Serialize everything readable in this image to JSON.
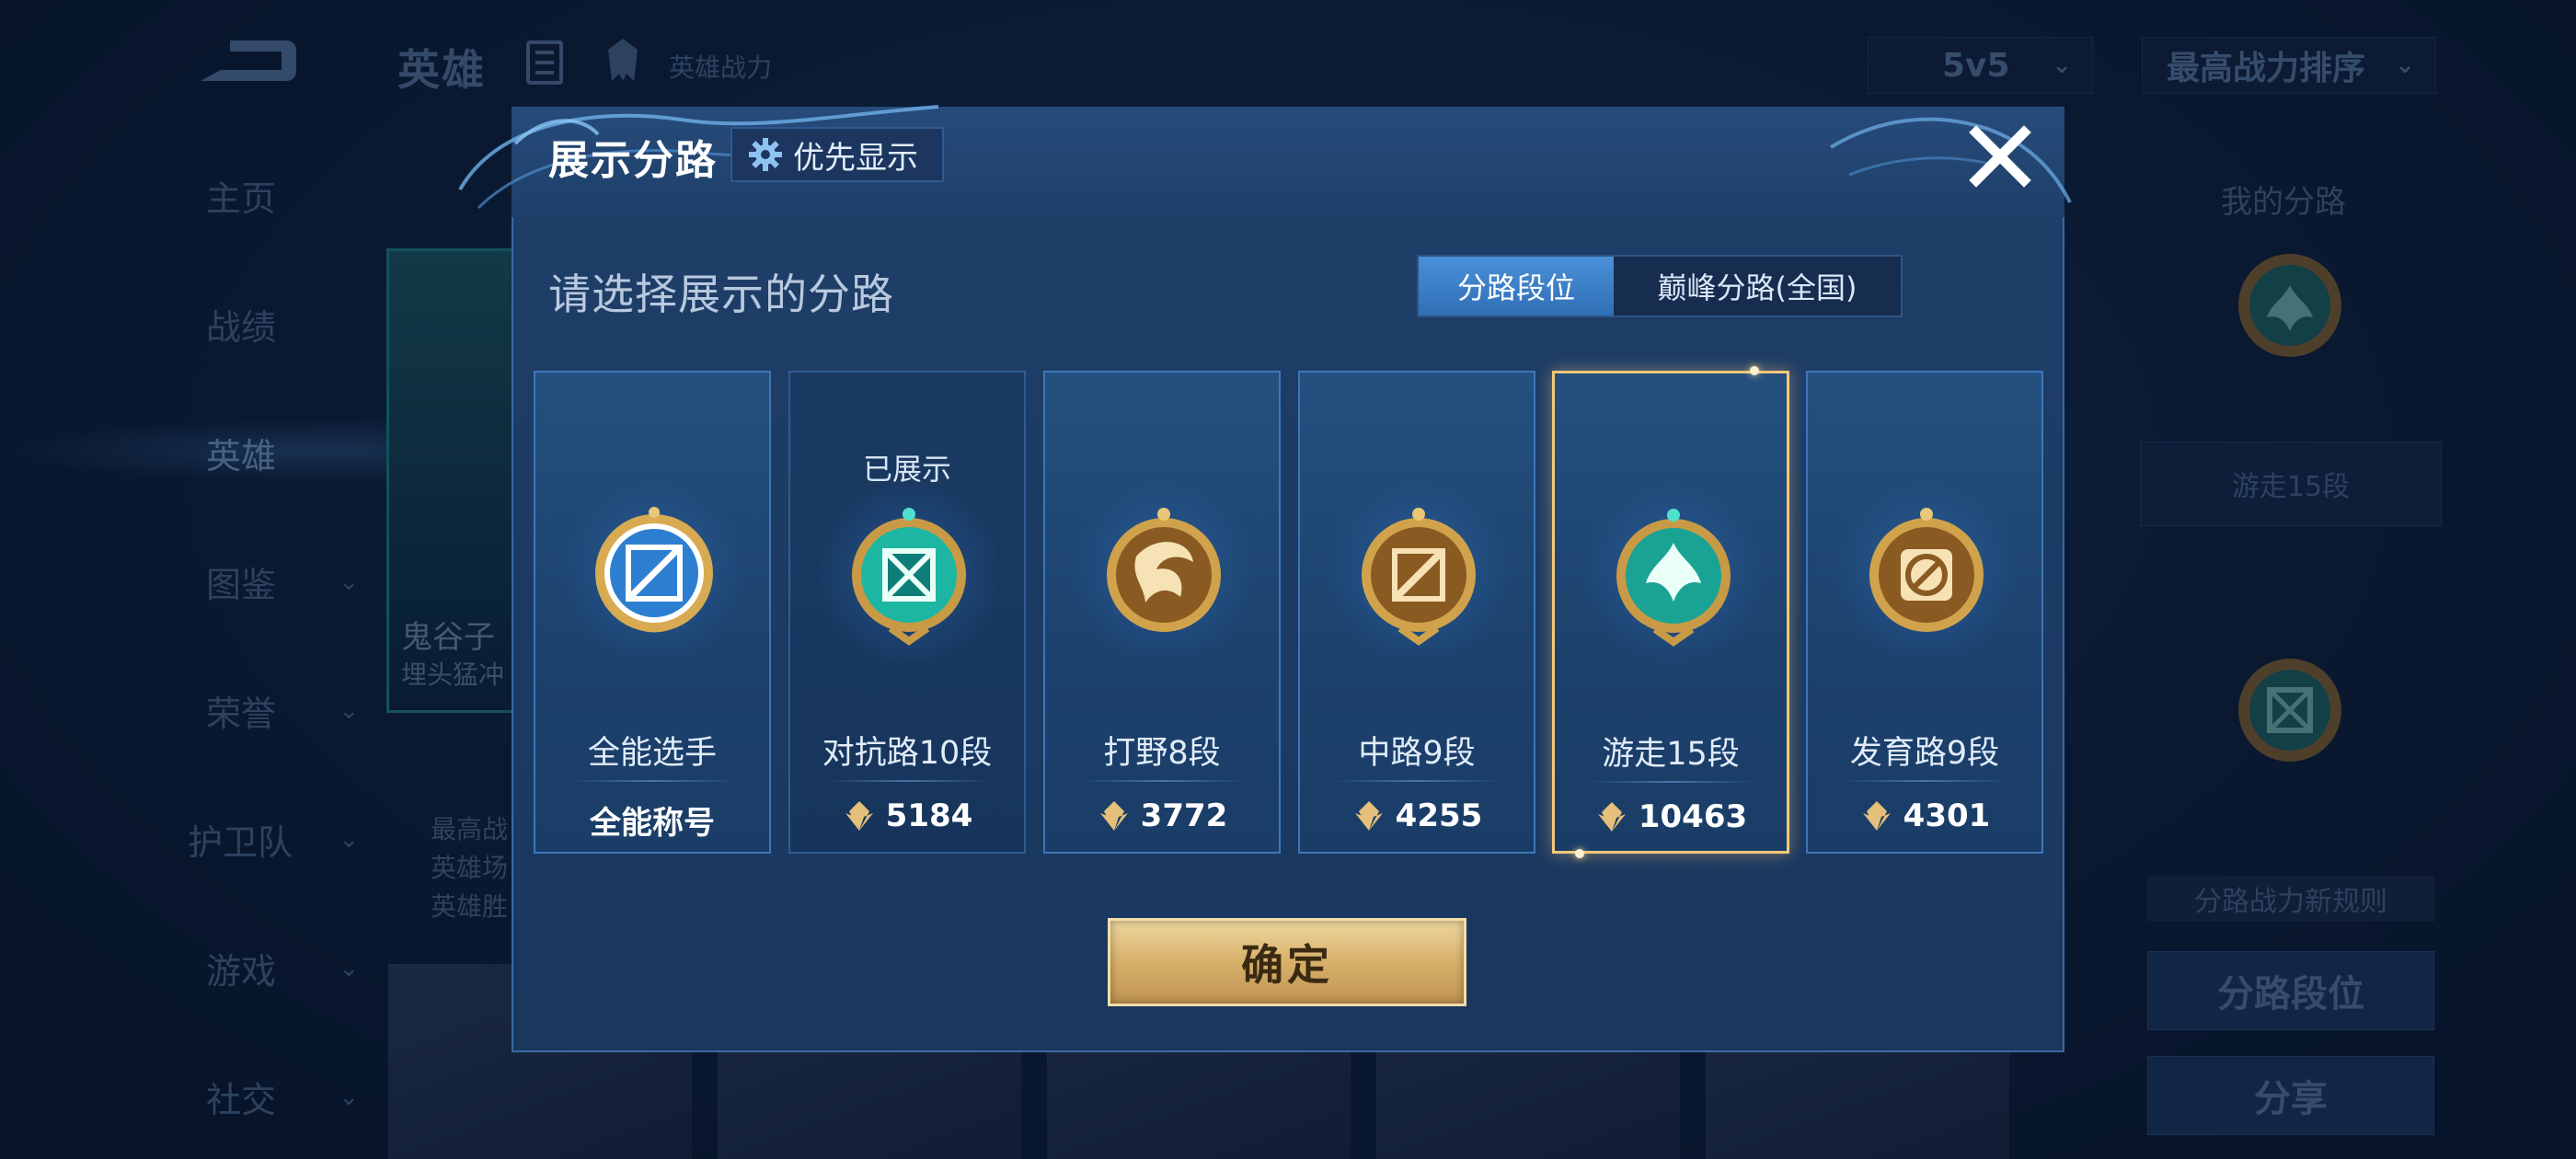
{
  "background": {
    "title": "英雄",
    "power_label": "英雄战力",
    "mode_dropdown": "5v5",
    "sort_dropdown": "最高战力排序",
    "sidebar": [
      {
        "label": "主页",
        "has_chevron": false
      },
      {
        "label": "战绩",
        "has_chevron": false
      },
      {
        "label": "英雄",
        "has_chevron": false,
        "active": true
      },
      {
        "label": "图鉴",
        "has_chevron": true
      },
      {
        "label": "荣誉",
        "has_chevron": true
      },
      {
        "label": "护卫队",
        "has_chevron": true
      },
      {
        "label": "游戏",
        "has_chevron": true
      },
      {
        "label": "社交",
        "has_chevron": true
      }
    ],
    "hero_name": "鬼谷子",
    "hero_subtitle": "埋头猛冲",
    "hero_info": [
      "最高战",
      "英雄场",
      "英雄胜"
    ],
    "right_panel": {
      "title": "我的分路",
      "current_lane": "游走15段",
      "rule_link": "分路战力新规则",
      "lane_rank_button": "分路段位",
      "share_button": "分享"
    }
  },
  "modal": {
    "title": "展示分路",
    "priority_button": "优先显示",
    "subtitle": "请选择展示的分路",
    "tabs": [
      {
        "label": "分路段位",
        "active": true
      },
      {
        "label": "巅峰分路(全国)",
        "active": false
      }
    ],
    "cards": [
      {
        "name": "全能选手",
        "value": "全能称号",
        "shown": "",
        "selected": false,
        "emblem": "all-round-emblem"
      },
      {
        "name": "对抗路10段",
        "value": "5184",
        "shown": "已展示",
        "selected": false,
        "emblem": "clash-lane-emblem"
      },
      {
        "name": "打野8段",
        "value": "3772",
        "shown": "",
        "selected": false,
        "emblem": "jungle-emblem"
      },
      {
        "name": "中路9段",
        "value": "4255",
        "shown": "",
        "selected": false,
        "emblem": "mid-lane-emblem"
      },
      {
        "name": "游走15段",
        "value": "10463",
        "shown": "",
        "selected": true,
        "emblem": "roam-emblem"
      },
      {
        "name": "发育路9段",
        "value": "4301",
        "shown": "",
        "selected": false,
        "emblem": "farm-lane-emblem"
      }
    ],
    "confirm_button": "确定"
  },
  "colors": {
    "modal_bg": "#1f3f69",
    "tab_active": "#3f82cc",
    "selected_border": "#f3c77a",
    "confirm_gold": "#d7b06a"
  }
}
